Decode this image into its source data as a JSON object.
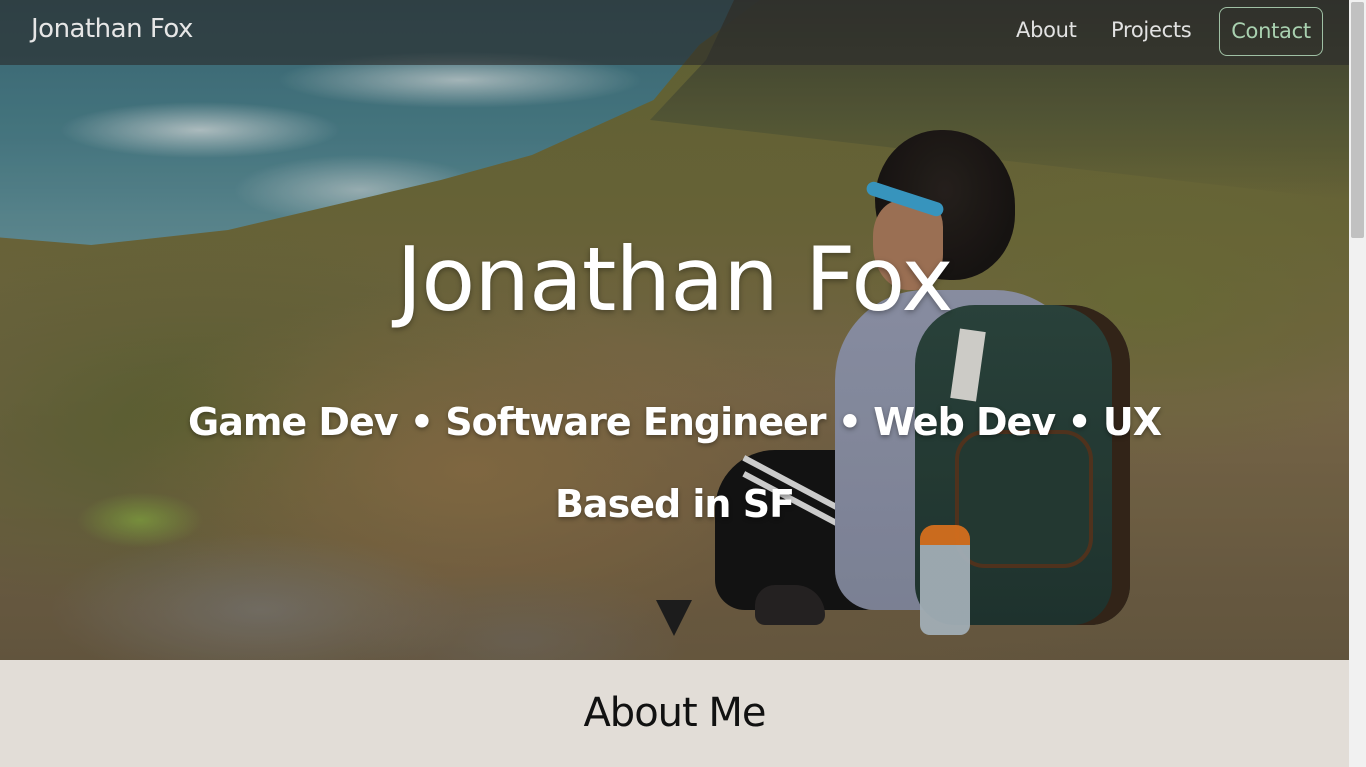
{
  "navbar": {
    "brand": "Jonathan Fox",
    "links": [
      {
        "label": "About"
      },
      {
        "label": "Projects"
      }
    ],
    "contact_label": "Contact"
  },
  "hero": {
    "title": "Jonathan Fox",
    "subtitle": "Game Dev • Software Engineer • Web Dev • UX",
    "location": "Based in SF",
    "scroll_icon": "triangle-down-icon"
  },
  "about": {
    "heading": "About Me"
  },
  "colors": {
    "navbar_bg": "#2a2a2a",
    "contact_accent": "#a9d1b0",
    "about_bg": "#e2ddd7",
    "hero_text": "#ffffff"
  }
}
